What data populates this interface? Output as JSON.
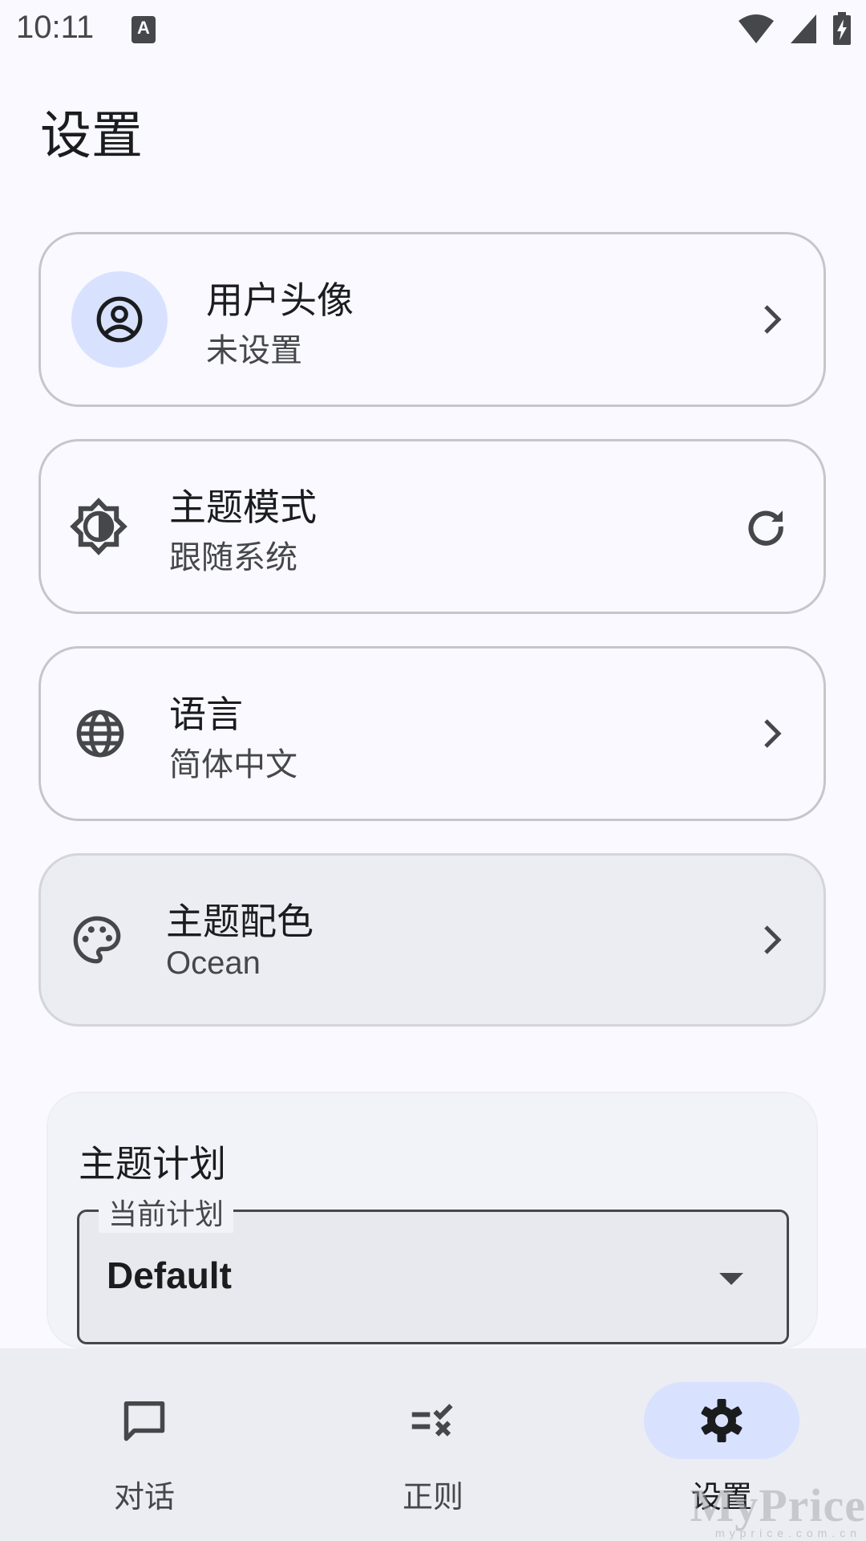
{
  "status_bar": {
    "time": "10:11",
    "notification_letter": "A"
  },
  "page": {
    "title": "设置"
  },
  "settings": {
    "avatar": {
      "title": "用户头像",
      "subtitle": "未设置"
    },
    "theme_mode": {
      "title": "主题模式",
      "subtitle": "跟随系统"
    },
    "language": {
      "title": "语言",
      "subtitle": "简体中文"
    },
    "theme_color": {
      "title": "主题配色",
      "subtitle": "Ocean"
    }
  },
  "theme_plan": {
    "title": "主题计划",
    "select_label": "当前计划",
    "select_value": "Default"
  },
  "bottom_nav": {
    "items": [
      {
        "label": "对话",
        "icon": "chat-icon",
        "active": false
      },
      {
        "label": "正则",
        "icon": "rule-icon",
        "active": false
      },
      {
        "label": "设置",
        "icon": "gear-icon",
        "active": true
      }
    ]
  },
  "watermark": {
    "text": "MyPrice",
    "sub": "myprice.com.cn"
  },
  "colors": {
    "background": "#F9F9FF",
    "accent_container": "#D8E2FF",
    "on_surface": "#1A1C1E",
    "on_surface_variant": "#45474A",
    "outline": "#C6C6CA"
  }
}
